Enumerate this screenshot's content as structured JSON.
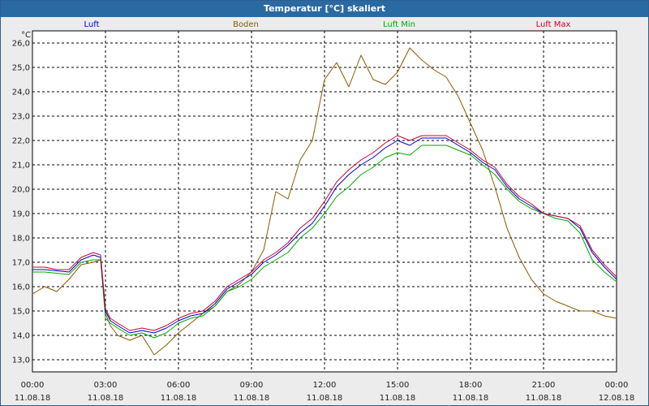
{
  "window": {
    "title": "Temperatur [°C] skaliert"
  },
  "chart_data": {
    "type": "line",
    "title": "Temperatur [°C] skaliert",
    "ylabel": "°C",
    "ylim": [
      12.5,
      26.5
    ],
    "xlim": [
      "2018-08-11 00:00",
      "2018-08-12 00:00"
    ],
    "grid": true,
    "legend": "top",
    "x_ticks": [
      {
        "time": "00:00",
        "date": "11.08.18"
      },
      {
        "time": "03:00",
        "date": "11.08.18"
      },
      {
        "time": "06:00",
        "date": "11.08.18"
      },
      {
        "time": "09:00",
        "date": "11.08.18"
      },
      {
        "time": "12:00",
        "date": "11.08.18"
      },
      {
        "time": "15:00",
        "date": "11.08.18"
      },
      {
        "time": "18:00",
        "date": "11.08.18"
      },
      {
        "time": "21:00",
        "date": "11.08.18"
      },
      {
        "time": "00:00",
        "date": "12.08.18"
      }
    ],
    "y_ticks": [
      "13,0",
      "14,0",
      "15,0",
      "16,0",
      "17,0",
      "18,0",
      "19,0",
      "20,0",
      "21,0",
      "22,0",
      "23,0",
      "24,0",
      "25,0",
      "26,0"
    ],
    "x_hours": [
      0,
      0.5,
      1,
      1.5,
      2,
      2.5,
      2.8,
      3,
      3.2,
      3.5,
      4,
      4.5,
      5,
      5.5,
      6,
      6.5,
      7,
      7.5,
      8,
      8.5,
      9,
      9.5,
      10,
      10.5,
      11,
      11.5,
      12,
      12.5,
      13,
      13.5,
      14,
      14.5,
      15,
      15.5,
      16,
      16.5,
      17,
      17.5,
      18,
      18.5,
      19,
      19.5,
      20,
      20.5,
      21,
      21.5,
      22,
      22.5,
      23,
      23.5,
      24
    ],
    "series": [
      {
        "name": "Luft",
        "color": "#0000cc",
        "values": [
          16.7,
          16.7,
          16.65,
          16.6,
          17.1,
          17.3,
          17.2,
          15.0,
          14.6,
          14.4,
          14.1,
          14.2,
          14.1,
          14.3,
          14.6,
          14.8,
          14.9,
          15.3,
          15.9,
          16.2,
          16.5,
          17.0,
          17.3,
          17.7,
          18.2,
          18.6,
          19.3,
          20.1,
          20.6,
          21.0,
          21.3,
          21.7,
          22.0,
          21.8,
          22.1,
          22.1,
          22.1,
          21.8,
          21.5,
          21.1,
          20.8,
          20.1,
          19.6,
          19.3,
          19.0,
          18.9,
          18.8,
          18.4,
          17.4,
          16.8,
          16.3
        ]
      },
      {
        "name": "Boden",
        "color": "#8b5a00",
        "values": [
          15.7,
          16.0,
          15.8,
          16.3,
          16.9,
          17.0,
          17.1,
          14.9,
          14.4,
          14.0,
          13.8,
          14.0,
          13.2,
          13.6,
          14.1,
          14.5,
          14.9,
          15.2,
          15.8,
          16.1,
          16.6,
          17.5,
          19.9,
          19.6,
          21.2,
          22.0,
          24.5,
          25.2,
          24.2,
          25.5,
          24.5,
          24.3,
          24.8,
          25.8,
          25.3,
          24.9,
          24.6,
          23.8,
          22.7,
          21.6,
          20.1,
          18.4,
          17.2,
          16.3,
          15.7,
          15.4,
          15.2,
          15.0,
          15.0,
          14.8,
          14.7
        ]
      },
      {
        "name": "Luft Min",
        "color": "#00aa00",
        "values": [
          16.6,
          16.6,
          16.55,
          16.5,
          17.0,
          17.1,
          17.1,
          14.7,
          14.5,
          14.3,
          14.0,
          14.1,
          13.9,
          14.1,
          14.5,
          14.7,
          14.8,
          15.2,
          15.8,
          16.0,
          16.3,
          16.8,
          17.1,
          17.4,
          18.0,
          18.4,
          19.0,
          19.7,
          20.1,
          20.6,
          20.9,
          21.3,
          21.5,
          21.4,
          21.8,
          21.8,
          21.8,
          21.6,
          21.4,
          21.0,
          20.6,
          20.0,
          19.5,
          19.2,
          19.0,
          18.8,
          18.7,
          18.2,
          17.1,
          16.6,
          16.2
        ]
      },
      {
        "name": "Luft Max",
        "color": "#cc0033",
        "values": [
          16.8,
          16.8,
          16.7,
          16.7,
          17.2,
          17.4,
          17.3,
          15.1,
          14.7,
          14.5,
          14.2,
          14.3,
          14.2,
          14.4,
          14.7,
          14.9,
          15.0,
          15.4,
          16.0,
          16.3,
          16.6,
          17.1,
          17.4,
          17.8,
          18.4,
          18.8,
          19.5,
          20.3,
          20.8,
          21.2,
          21.5,
          21.9,
          22.2,
          22.0,
          22.2,
          22.2,
          22.2,
          21.9,
          21.6,
          21.2,
          20.9,
          20.2,
          19.7,
          19.4,
          19.0,
          18.9,
          18.8,
          18.5,
          17.5,
          16.9,
          16.4
        ]
      }
    ]
  }
}
